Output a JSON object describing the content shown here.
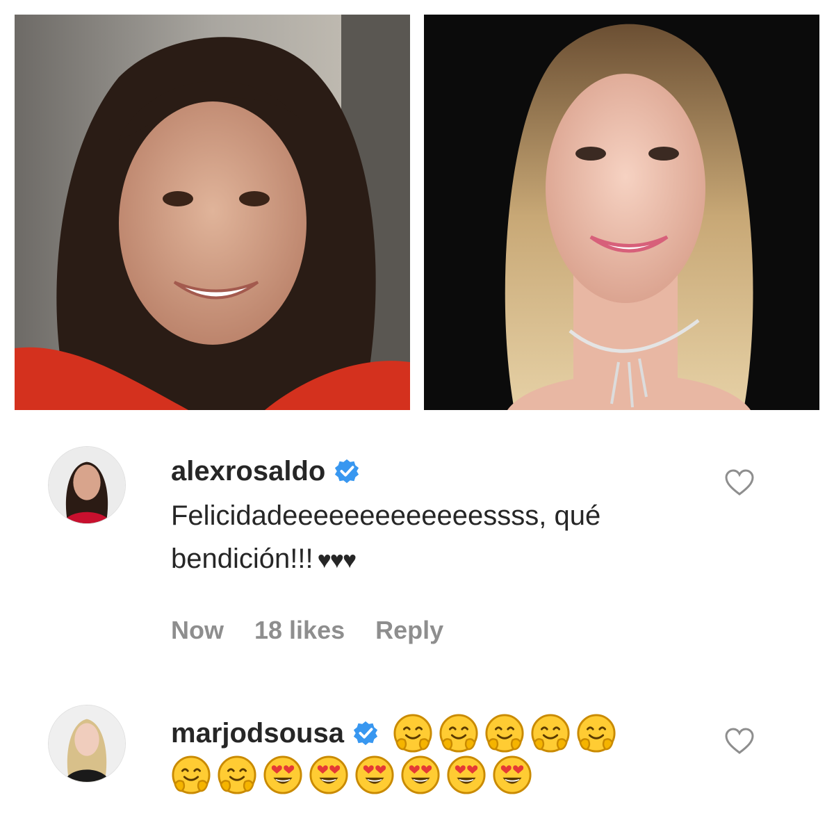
{
  "comments": [
    {
      "username": "alexrosaldo",
      "text": "Felicidadeeeeeeeeeeeeessss, qué bendición!!!",
      "hearts": "♥♥♥",
      "time": "Now",
      "likes": "18 likes",
      "reply": "Reply",
      "verified_icon": "verified-badge-icon",
      "like_icon": "heart-outline-icon"
    },
    {
      "username": "marjodsousa",
      "emoji_line1": [
        "hugging-face",
        "hugging-face",
        "hugging-face",
        "hugging-face",
        "hugging-face"
      ],
      "emoji_line2": [
        "hugging-face",
        "hugging-face",
        "heart-eyes",
        "heart-eyes",
        "heart-eyes",
        "heart-eyes",
        "heart-eyes",
        "heart-eyes"
      ],
      "verified_icon": "verified-badge-icon",
      "like_icon": "heart-outline-icon"
    }
  ],
  "colors": {
    "text": "#262626",
    "meta": "#8e8e8e",
    "verified": "#3897f0"
  }
}
